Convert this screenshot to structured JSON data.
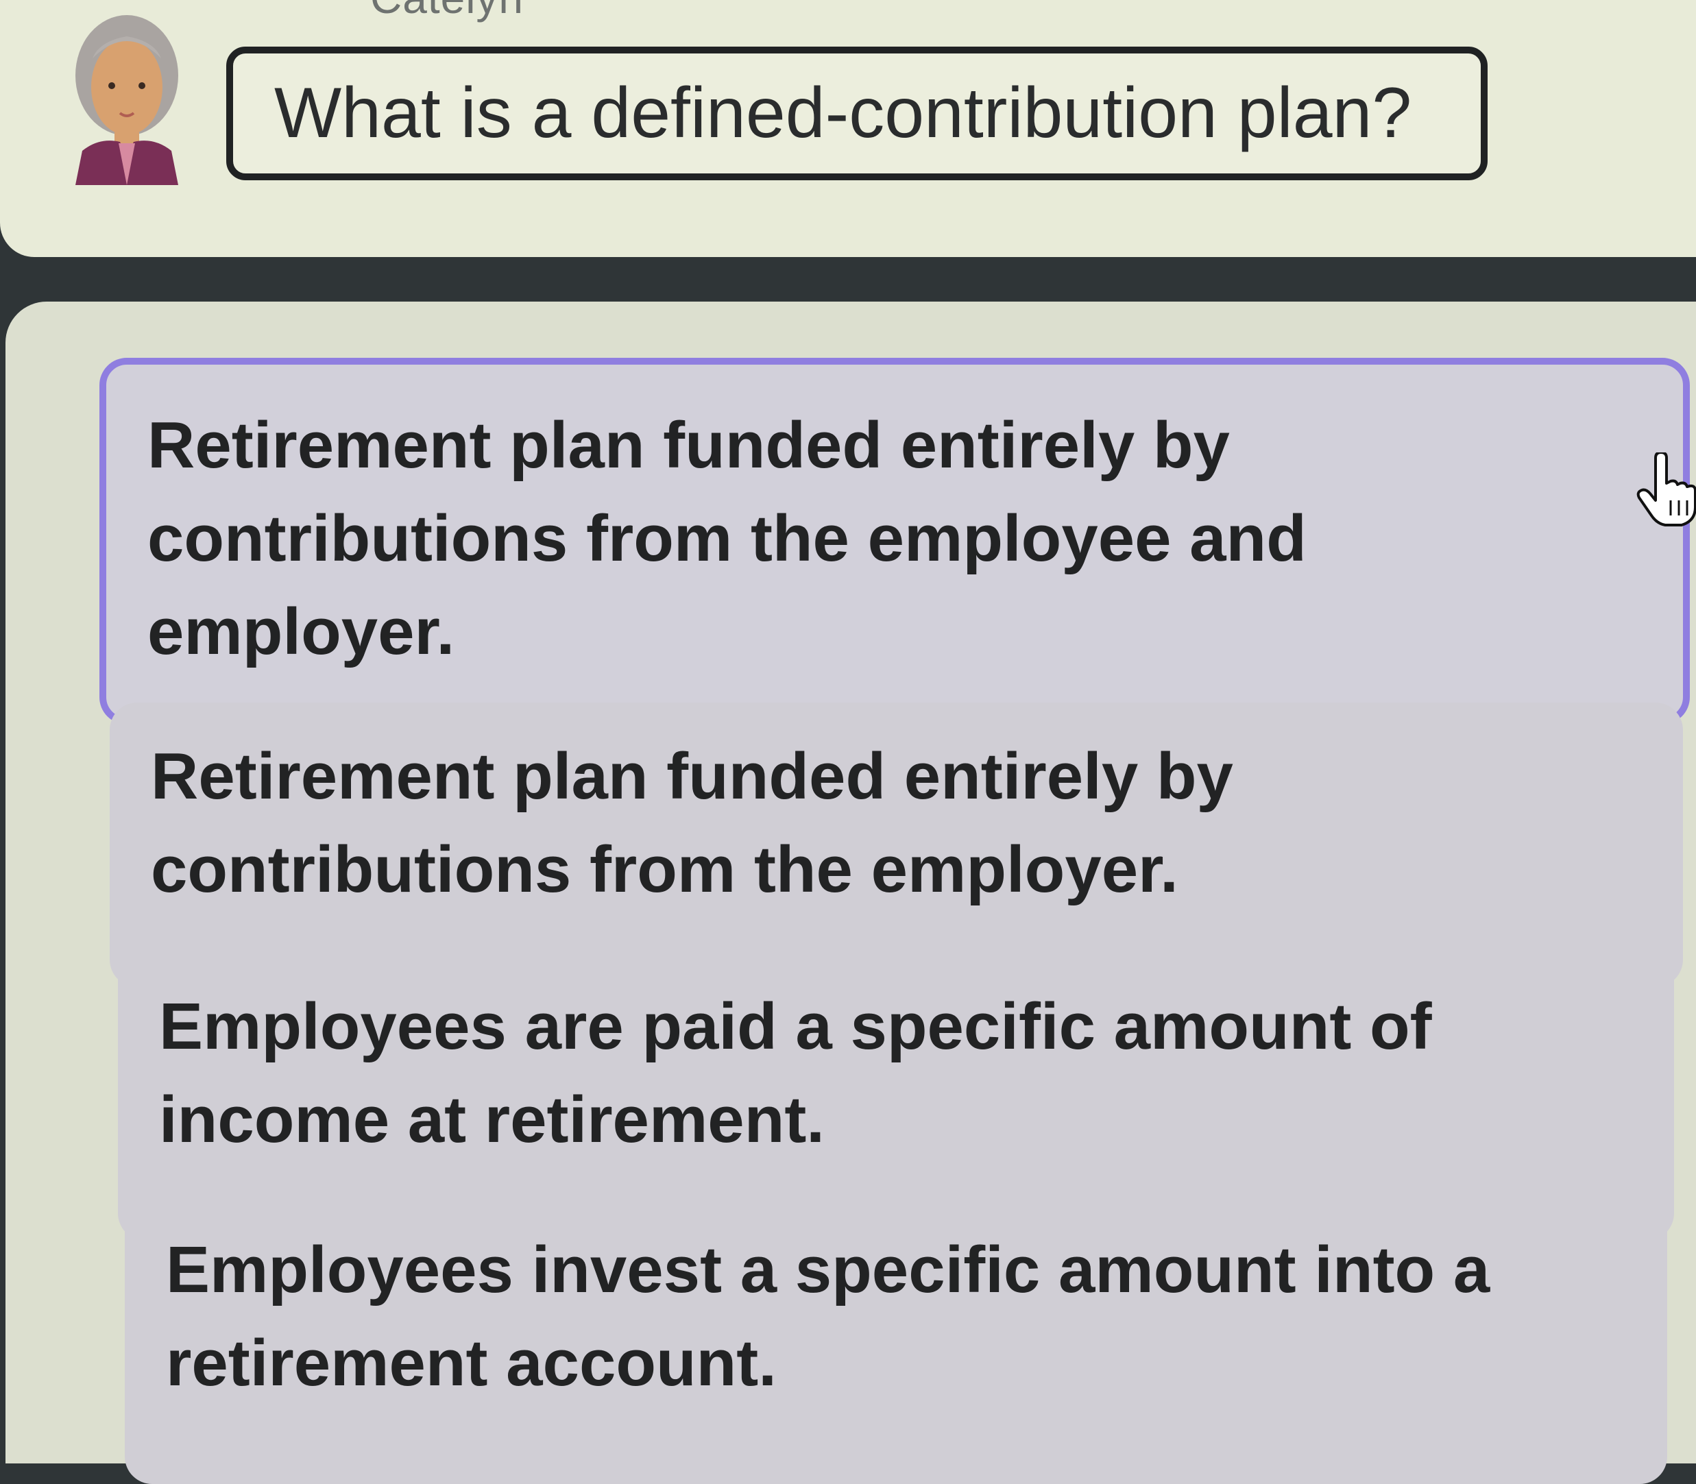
{
  "speaker": {
    "name": "Catelyn"
  },
  "question": {
    "text": "What is a defined-contribution plan?"
  },
  "options": [
    {
      "label": "Retirement plan funded entirely by contributions from the employee and employer.",
      "selected": true
    },
    {
      "label": "Retirement plan funded entirely by contributions from the employer.",
      "selected": false
    },
    {
      "label": "Employees are paid a specific amount of income at retirement.",
      "selected": false
    },
    {
      "label": "Employees invest a specific amount into a retirement account.",
      "selected": false
    }
  ],
  "colors": {
    "selection_border": "#8f7ee0",
    "option_background": "#d0ced5",
    "panel_background": "#dcdfcf",
    "frame_dark": "#2f3537"
  },
  "icons": {
    "avatar": "woman-avatar-icon",
    "cursor": "hand-pointer-icon"
  }
}
